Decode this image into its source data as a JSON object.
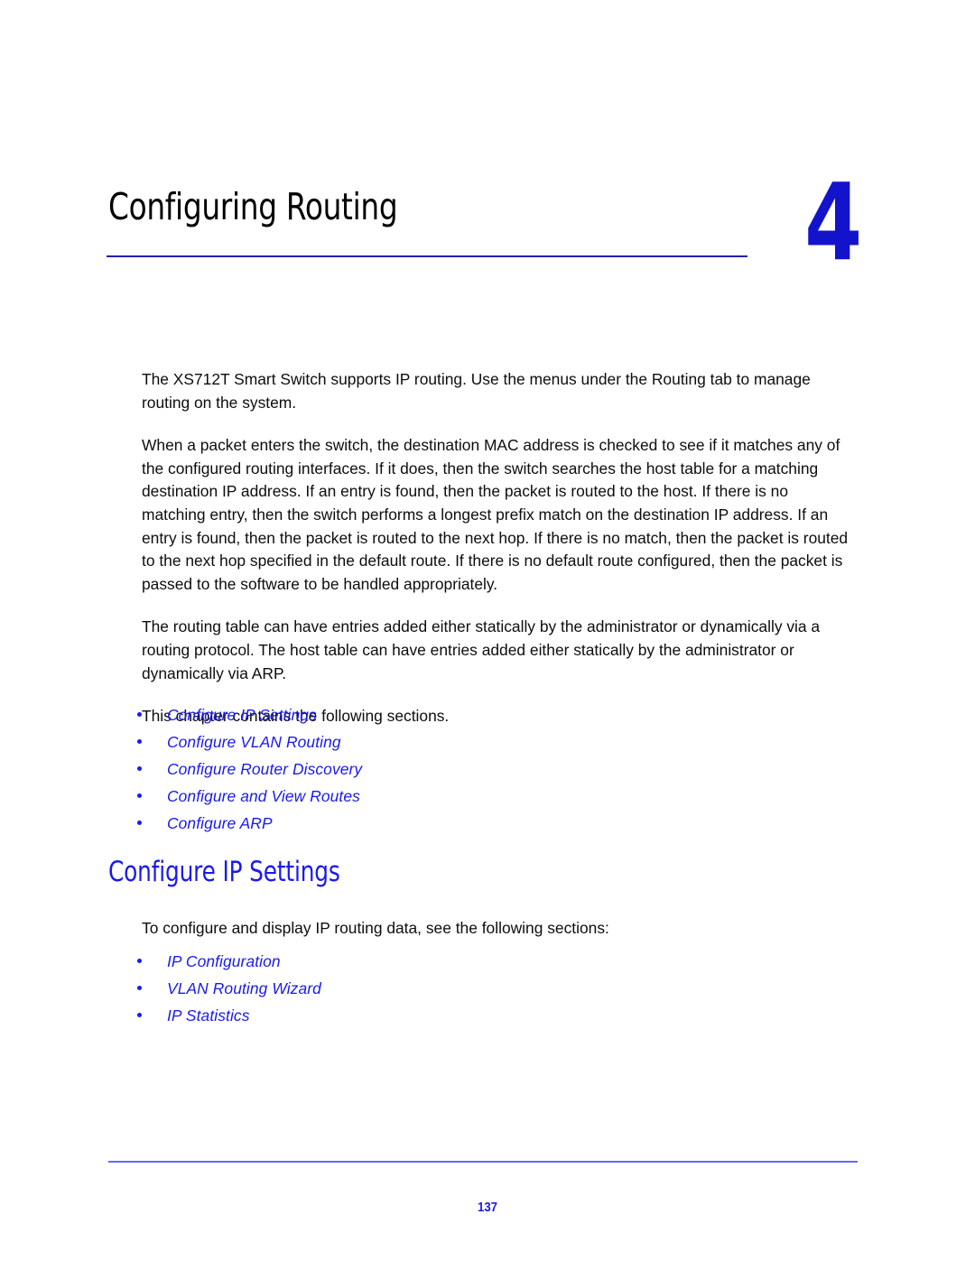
{
  "chapter": {
    "title": "Configuring Routing",
    "number": "4"
  },
  "intro": {
    "paragraph_1": "The XS712T Smart Switch supports IP routing. Use the menus under the Routing tab to manage routing on the system.",
    "paragraph_2": "When a packet enters the switch, the destination MAC address is checked to see if it matches any of the configured routing interfaces. If it does, then the switch searches the host table for a matching destination IP address. If an entry is found, then the packet is routed to the host. If there is no matching entry, then the switch performs a longest prefix match on the destination IP address. If an entry is found, then the packet is routed to the next hop. If there is no match, then the packet is routed to the next hop specified in the default route. If there is no default route configured, then the packet is passed to the software to be handled appropriately.",
    "paragraph_3": "The routing table can have entries added either statically by the administrator or dynamically via a routing protocol. The host table can have entries added either statically by the administrator or dynamically via ARP.",
    "paragraph_4": "This chapter contains the following sections."
  },
  "chapter_links": [
    {
      "label": "Configure IP Settings"
    },
    {
      "label": "Configure VLAN Routing"
    },
    {
      "label": "Configure Router Discovery"
    },
    {
      "label": "Configure and View Routes"
    },
    {
      "label": "Configure ARP"
    }
  ],
  "section": {
    "heading": "Configure IP Settings",
    "lead_in": "To configure and display IP routing data, see the following sections:",
    "links": [
      {
        "label": "IP Configuration"
      },
      {
        "label": "VLAN Routing Wizard"
      },
      {
        "label": "IP Statistics"
      }
    ]
  },
  "footer": {
    "page_number": "137"
  },
  "colors": {
    "link_blue": "#1a1aee",
    "chapter_number_blue": "#1313cc",
    "chapter_rule_blue": "#2222aa",
    "footer_rule_blue": "#6666ff",
    "body_black": "#0d0d0d"
  }
}
